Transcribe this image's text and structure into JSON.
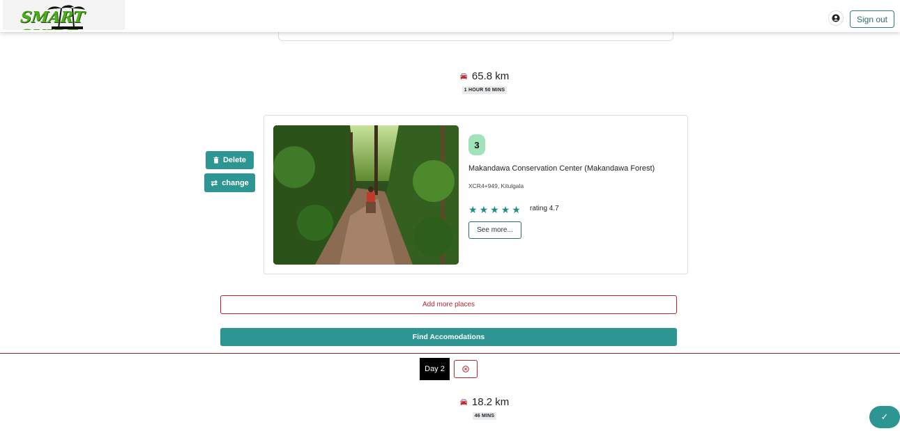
{
  "header": {
    "logo_text": "SMART GUIDE",
    "user_icon": "user-circle-icon",
    "signout_label": "Sign out"
  },
  "routes": [
    {
      "distance": "65.8 km",
      "duration": "1 HOUR 50 MINS",
      "icon": "car-icon"
    },
    {
      "distance": "18.2 km",
      "duration": "46 MINS",
      "icon": "car-icon"
    }
  ],
  "place_actions": {
    "delete_label": "Delete",
    "change_label": "change",
    "delete_icon": "trash-icon",
    "change_icon": "swap-icon"
  },
  "place": {
    "number": "3",
    "name": "Makandawa Conservation Center (Makandawa Forest)",
    "address": "XCR4+949, Kitulgala",
    "stars": 4.5,
    "rating_text": "rating 4.7",
    "see_more_label": "See more..."
  },
  "actions": {
    "add_more_label": "Add more places",
    "find_accommodations_label": "Find Accomodations"
  },
  "day": {
    "label": "Day 2",
    "remove_icon": "close-circle-icon"
  },
  "fab": {
    "icon": "check-icon"
  },
  "colors": {
    "accent": "#2e9692",
    "danger": "#b3262f",
    "badge": "#9fe3b8"
  }
}
